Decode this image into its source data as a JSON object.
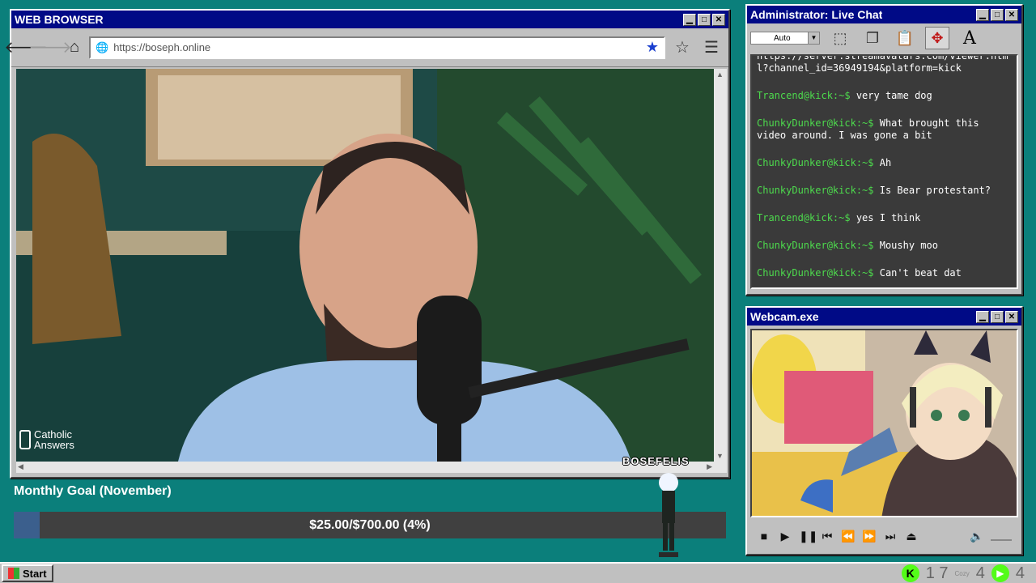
{
  "browser": {
    "title": "WEB BROWSER",
    "url": "https://boseph.online",
    "overlay_logo": "Catholic Answers",
    "minimize": "▁",
    "maximize": "□",
    "close": "✕"
  },
  "chat": {
    "title": "Administrator: Live Chat",
    "font_select": "Auto",
    "top_line": "https://server.streamavatars.com/viewer.html?channel_id=36949194&platform=kick",
    "messages": [
      {
        "user": "Trancend@kick:~$",
        "text": "very tame dog"
      },
      {
        "user": "ChunkyDunker@kick:~$",
        "text": "What brought this video around. I was gone a bit"
      },
      {
        "user": "ChunkyDunker@kick:~$",
        "text": "Ah"
      },
      {
        "user": "ChunkyDunker@kick:~$",
        "text": "Is Bear protestant?"
      },
      {
        "user": "Trancend@kick:~$",
        "text": "yes I think"
      },
      {
        "user": "ChunkyDunker@kick:~$",
        "text": "Moushy moo"
      },
      {
        "user": "ChunkyDunker@kick:~$",
        "text": "Can't beat dat"
      }
    ]
  },
  "webcam": {
    "title": "Webcam.exe"
  },
  "goal": {
    "title": "Monthly Goal (November)",
    "text": "$25.00/$700.00 (4%)",
    "progress": 0.036
  },
  "overlay": {
    "name_tag": "BOSEFELIS"
  },
  "taskbar": {
    "start": "Start",
    "count1": "1 7",
    "count2": "4",
    "count3": "4",
    "cozy": "Cozy"
  },
  "colors": {
    "desktop": "#0b7f7b",
    "titlebar": "#000a86",
    "chat_user": "#4ddb4d",
    "goal_fill": "#3b5f8d"
  }
}
